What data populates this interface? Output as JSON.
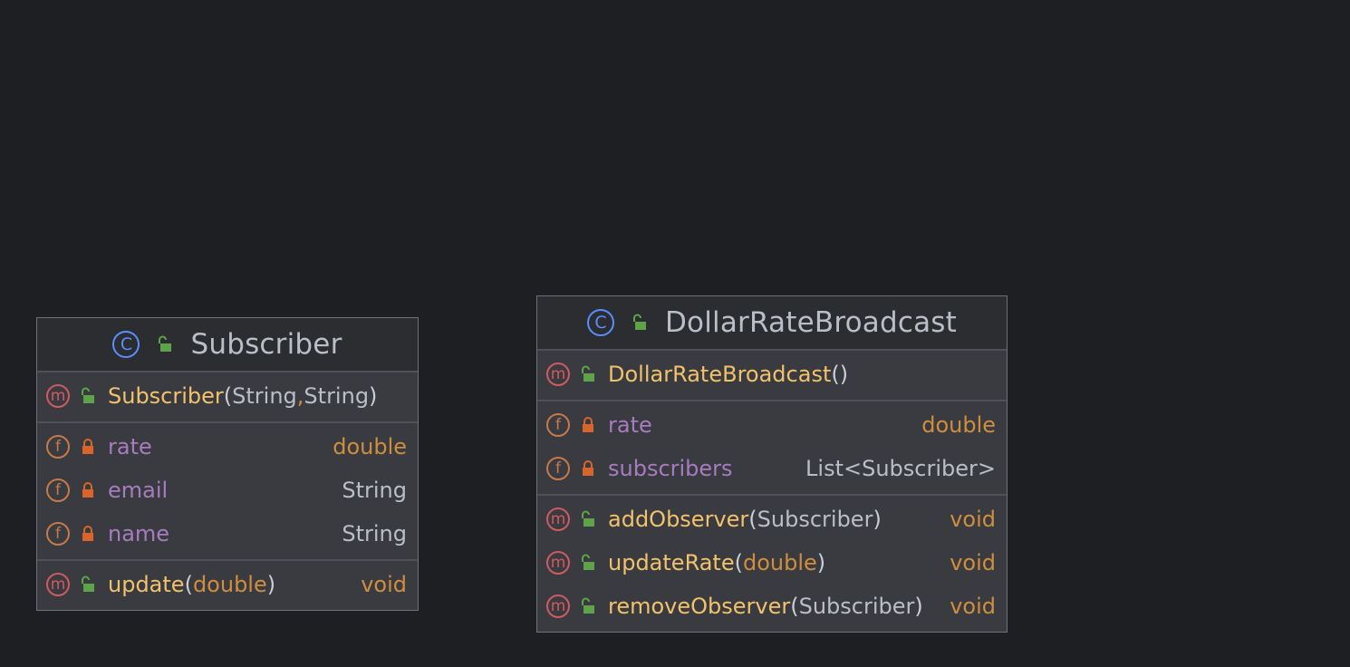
{
  "classes": [
    {
      "name": "Subscriber",
      "constructors": [
        {
          "name": "Subscriber",
          "open": "(",
          "params": [
            "String",
            ", ",
            "String"
          ],
          "close": ")"
        }
      ],
      "fields": [
        {
          "name": "rate",
          "type": "double"
        },
        {
          "name": "email",
          "type": "String"
        },
        {
          "name": "name",
          "type": "String"
        }
      ],
      "methods": [
        {
          "name": "update",
          "open": "(",
          "param": "double",
          "close": ")",
          "type": "void"
        }
      ]
    },
    {
      "name": "DollarRateBroadcast",
      "constructors": [
        {
          "name": "DollarRateBroadcast",
          "parens": "()"
        }
      ],
      "fields": [
        {
          "name": "rate",
          "type": "double"
        },
        {
          "name": "subscribers",
          "type": "List<Subscriber>"
        }
      ],
      "methods": [
        {
          "name": "addObserver",
          "open": "(",
          "param": "Subscriber",
          "close": ")",
          "type": "void"
        },
        {
          "name": "updateRate",
          "open": "(",
          "param": "double",
          "close": ")",
          "type": "void"
        },
        {
          "name": "removeObserver",
          "open": "(",
          "param": "Subscriber",
          "close": ")",
          "type": "void"
        }
      ]
    }
  ],
  "icons": {
    "class_badge": "C",
    "method_badge": "m",
    "field_badge": "f",
    "public_icon": "unlocked-lock-icon",
    "private_icon": "locked-lock-icon"
  },
  "colors": {
    "background": "#1e1f22",
    "box_body": "#393b40",
    "box_header": "#2b2d30",
    "method_name": "#f2c26b",
    "field_name": "#a77cbf",
    "primitive_type": "#cf8e3e",
    "ref_type": "#b9bec8",
    "method_badge": "#d05a61",
    "field_badge": "#c57a4b",
    "class_badge": "#5a8eff",
    "public_lock": "#5ea34a",
    "private_lock": "#d8652c"
  }
}
